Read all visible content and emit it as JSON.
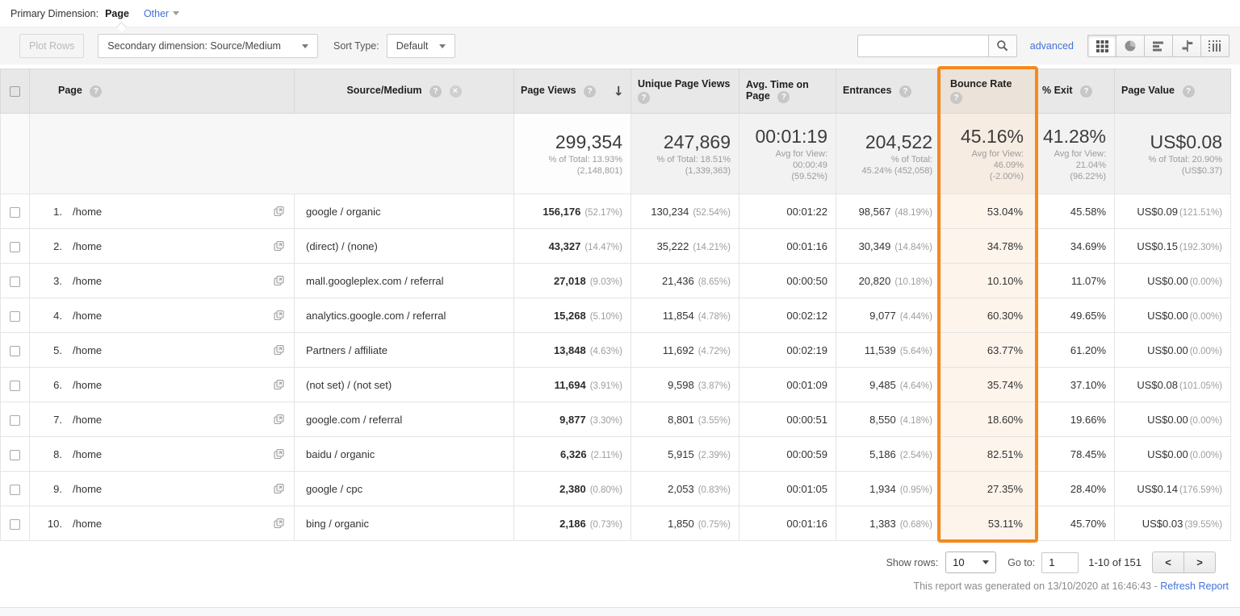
{
  "primary_dimension": {
    "label": "Primary Dimension:",
    "selected": "Page",
    "other": "Other"
  },
  "toolbar": {
    "plot_rows": "Plot Rows",
    "secondary_dimension": "Secondary dimension: Source/Medium",
    "sort_type_label": "Sort Type:",
    "sort_type_value": "Default",
    "advanced": "advanced"
  },
  "search": {
    "value": ""
  },
  "icons": {
    "help": "?",
    "remove": "×",
    "sort_desc": "↓",
    "prev": "<",
    "next": ">"
  },
  "table": {
    "headers": {
      "page": "Page",
      "source": "Source/Medium",
      "page_views": "Page Views",
      "unique_page_views": "Unique Page Views",
      "avg_time": "Avg. Time on Page",
      "entrances": "Entrances",
      "bounce_rate": "Bounce Rate",
      "pct_exit": "% Exit",
      "page_value": "Page Value"
    },
    "summary": {
      "page_views": {
        "value": "299,354",
        "sub1": "% of Total: 13.93%",
        "sub2": "(2,148,801)",
        "sub3": ""
      },
      "unique_page_views": {
        "value": "247,869",
        "sub1": "% of Total: 18.51%",
        "sub2": "(1,339,363)",
        "sub3": ""
      },
      "avg_time": {
        "value": "00:01:19",
        "sub1": "Avg for View:",
        "sub2": "00:00:49",
        "sub3": "(59.52%)"
      },
      "entrances": {
        "value": "204,522",
        "sub1": "% of Total:",
        "sub2": "45.24% (452,058)",
        "sub3": ""
      },
      "bounce_rate": {
        "value": "45.16%",
        "sub1": "Avg for View:",
        "sub2": "46.09%",
        "sub3": "(-2.00%)"
      },
      "pct_exit": {
        "value": "41.28%",
        "sub1": "Avg for View:",
        "sub2": "21.04%",
        "sub3": "(96.22%)"
      },
      "page_value": {
        "value": "US$0.08",
        "sub1": "% of Total: 20.90%",
        "sub2": "(US$0.37)",
        "sub3": ""
      }
    },
    "rows": [
      {
        "rank": "1.",
        "page": "/home",
        "source": "google / organic",
        "pv": "156,176",
        "pv_pct": "(52.17%)",
        "upv": "130,234",
        "upv_pct": "(52.54%)",
        "time": "00:01:22",
        "entr": "98,567",
        "entr_pct": "(48.19%)",
        "bounce": "53.04%",
        "exit": "45.58%",
        "value": "US$0.09",
        "value_pct": "(121.51%)"
      },
      {
        "rank": "2.",
        "page": "/home",
        "source": "(direct) / (none)",
        "pv": "43,327",
        "pv_pct": "(14.47%)",
        "upv": "35,222",
        "upv_pct": "(14.21%)",
        "time": "00:01:16",
        "entr": "30,349",
        "entr_pct": "(14.84%)",
        "bounce": "34.78%",
        "exit": "34.69%",
        "value": "US$0.15",
        "value_pct": "(192.30%)"
      },
      {
        "rank": "3.",
        "page": "/home",
        "source": "mall.googleplex.com / referral",
        "pv": "27,018",
        "pv_pct": "(9.03%)",
        "upv": "21,436",
        "upv_pct": "(8.65%)",
        "time": "00:00:50",
        "entr": "20,820",
        "entr_pct": "(10.18%)",
        "bounce": "10.10%",
        "exit": "11.07%",
        "value": "US$0.00",
        "value_pct": "(0.00%)"
      },
      {
        "rank": "4.",
        "page": "/home",
        "source": "analytics.google.com / referral",
        "pv": "15,268",
        "pv_pct": "(5.10%)",
        "upv": "11,854",
        "upv_pct": "(4.78%)",
        "time": "00:02:12",
        "entr": "9,077",
        "entr_pct": "(4.44%)",
        "bounce": "60.30%",
        "exit": "49.65%",
        "value": "US$0.00",
        "value_pct": "(0.00%)"
      },
      {
        "rank": "5.",
        "page": "/home",
        "source": "Partners / affiliate",
        "pv": "13,848",
        "pv_pct": "(4.63%)",
        "upv": "11,692",
        "upv_pct": "(4.72%)",
        "time": "00:02:19",
        "entr": "11,539",
        "entr_pct": "(5.64%)",
        "bounce": "63.77%",
        "exit": "61.20%",
        "value": "US$0.00",
        "value_pct": "(0.00%)"
      },
      {
        "rank": "6.",
        "page": "/home",
        "source": "(not set) / (not set)",
        "pv": "11,694",
        "pv_pct": "(3.91%)",
        "upv": "9,598",
        "upv_pct": "(3.87%)",
        "time": "00:01:09",
        "entr": "9,485",
        "entr_pct": "(4.64%)",
        "bounce": "35.74%",
        "exit": "37.10%",
        "value": "US$0.08",
        "value_pct": "(101.05%)"
      },
      {
        "rank": "7.",
        "page": "/home",
        "source": "google.com / referral",
        "pv": "9,877",
        "pv_pct": "(3.30%)",
        "upv": "8,801",
        "upv_pct": "(3.55%)",
        "time": "00:00:51",
        "entr": "8,550",
        "entr_pct": "(4.18%)",
        "bounce": "18.60%",
        "exit": "19.66%",
        "value": "US$0.00",
        "value_pct": "(0.00%)"
      },
      {
        "rank": "8.",
        "page": "/home",
        "source": "baidu / organic",
        "pv": "6,326",
        "pv_pct": "(2.11%)",
        "upv": "5,915",
        "upv_pct": "(2.39%)",
        "time": "00:00:59",
        "entr": "5,186",
        "entr_pct": "(2.54%)",
        "bounce": "82.51%",
        "exit": "78.45%",
        "value": "US$0.00",
        "value_pct": "(0.00%)"
      },
      {
        "rank": "9.",
        "page": "/home",
        "source": "google / cpc",
        "pv": "2,380",
        "pv_pct": "(0.80%)",
        "upv": "2,053",
        "upv_pct": "(0.83%)",
        "time": "00:01:05",
        "entr": "1,934",
        "entr_pct": "(0.95%)",
        "bounce": "27.35%",
        "exit": "28.40%",
        "value": "US$0.14",
        "value_pct": "(176.59%)"
      },
      {
        "rank": "10.",
        "page": "/home",
        "source": "bing / organic",
        "pv": "2,186",
        "pv_pct": "(0.73%)",
        "upv": "1,850",
        "upv_pct": "(0.75%)",
        "time": "00:01:16",
        "entr": "1,383",
        "entr_pct": "(0.68%)",
        "bounce": "53.11%",
        "exit": "45.70%",
        "value": "US$0.03",
        "value_pct": "(39.55%)"
      }
    ]
  },
  "footer": {
    "show_rows_label": "Show rows:",
    "show_rows_value": "10",
    "goto_label": "Go to:",
    "goto_value": "1",
    "range": "1-10 of 151"
  },
  "status": {
    "generated": "This report was generated on 13/10/2020 at 16:46:43 - ",
    "refresh": "Refresh Report"
  },
  "colors": {
    "highlight_orange": "#f6891c",
    "bounce_tint_body": "#fdf4ec",
    "bounce_tint_summary": "#f7ece2",
    "bounce_tint_header": "#ebe3da",
    "link_blue": "#4272d8",
    "header_gray": "#e8e8e8"
  }
}
